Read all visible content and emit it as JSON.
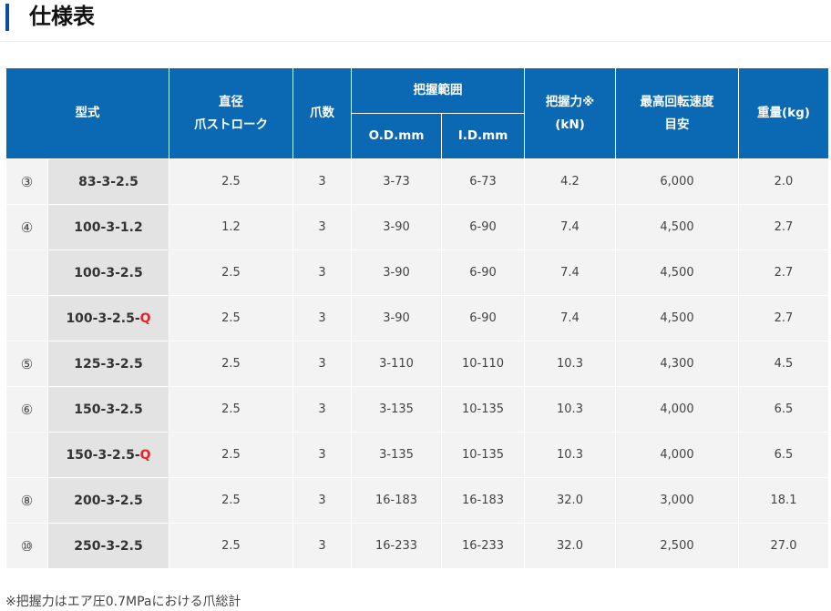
{
  "page": {
    "title": "仕様表",
    "note": "※把握力はエア圧0.7MPaにおける爪総計"
  },
  "table": {
    "headers": {
      "model": "型式",
      "stroke_line1": "直径",
      "stroke_line2": "爪ストローク",
      "claws": "爪数",
      "grip_range": "把握範囲",
      "od": "O.D.mm",
      "id": "I.D.mm",
      "force_line1": "把握力※",
      "force_line2": "(kN)",
      "speed_line1": "最高回転速度",
      "speed_line2": "目安",
      "weight": "重量(kg)"
    },
    "rows": [
      {
        "mark": "③",
        "model_base": "83-3-2.5",
        "model_suffix": "",
        "stroke": "2.5",
        "stroke_red": false,
        "claws": "3",
        "od": "3-73",
        "id": "6-73",
        "force": "4.2",
        "speed": "6,000",
        "weight": "2.0"
      },
      {
        "mark": "④",
        "model_base": "100-3-1.2",
        "model_suffix": "",
        "stroke": "1.2",
        "stroke_red": true,
        "claws": "3",
        "od": "3-90",
        "id": "6-90",
        "force": "7.4",
        "speed": "4,500",
        "weight": "2.7"
      },
      {
        "mark": "",
        "model_base": "100-3-2.5",
        "model_suffix": "",
        "stroke": "2.5",
        "stroke_red": false,
        "claws": "3",
        "od": "3-90",
        "id": "6-90",
        "force": "7.4",
        "speed": "4,500",
        "weight": "2.7"
      },
      {
        "mark": "",
        "model_base": "100-3-2.5-",
        "model_suffix": "Q",
        "stroke": "2.5",
        "stroke_red": false,
        "claws": "3",
        "od": "3-90",
        "id": "6-90",
        "force": "7.4",
        "speed": "4,500",
        "weight": "2.7"
      },
      {
        "mark": "⑤",
        "model_base": "125-3-2.5",
        "model_suffix": "",
        "stroke": "2.5",
        "stroke_red": false,
        "claws": "3",
        "od": "3-110",
        "id": "10-110",
        "force": "10.3",
        "speed": "4,300",
        "weight": "4.5"
      },
      {
        "mark": "⑥",
        "model_base": "150-3-2.5",
        "model_suffix": "",
        "stroke": "2.5",
        "stroke_red": false,
        "claws": "3",
        "od": "3-135",
        "id": "10-135",
        "force": "10.3",
        "speed": "4,000",
        "weight": "6.5"
      },
      {
        "mark": "",
        "model_base": "150-3-2.5-",
        "model_suffix": "Q",
        "stroke": "2.5",
        "stroke_red": false,
        "claws": "3",
        "od": "3-135",
        "id": "10-135",
        "force": "10.3",
        "speed": "4,000",
        "weight": "6.5"
      },
      {
        "mark": "⑧",
        "model_base": "200-3-2.5",
        "model_suffix": "",
        "stroke": "2.5",
        "stroke_red": false,
        "claws": "3",
        "od": "16-183",
        "id": "16-183",
        "force": "32.0",
        "speed": "3,000",
        "weight": "18.1"
      },
      {
        "mark": "⑩",
        "model_base": "250-3-2.5",
        "model_suffix": "",
        "stroke": "2.5",
        "stroke_red": false,
        "claws": "3",
        "od": "16-233",
        "id": "16-233",
        "force": "32.0",
        "speed": "2,500",
        "weight": "27.0"
      }
    ]
  },
  "colors": {
    "header_bg": "#0b68b3",
    "title_accent": "#0a4f9c",
    "highlight_red": "#e0262d"
  }
}
